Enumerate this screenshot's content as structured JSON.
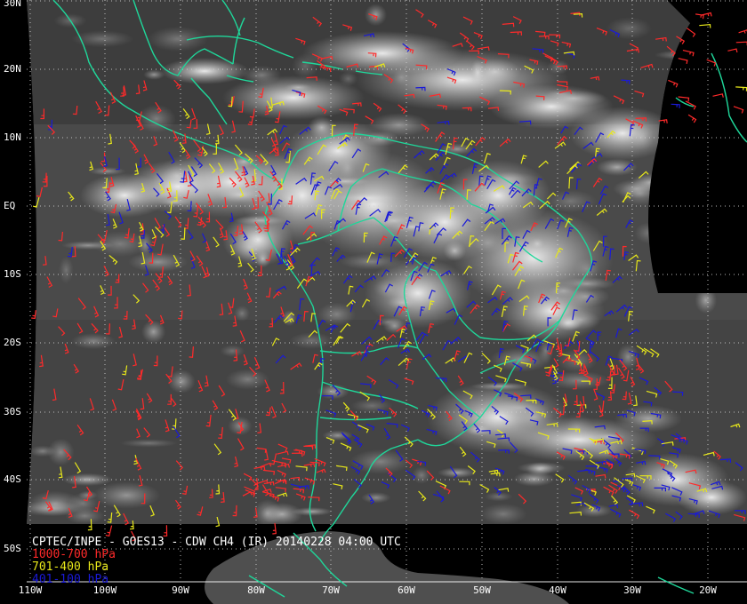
{
  "caption": "CPTEC/INPE - GOES13 - CDW CH4 (IR) 20140228 04:00 UTC",
  "legend": [
    {
      "label": "1000-700 hPa",
      "color": "#ff2a2a"
    },
    {
      "label": "701-400 hPa",
      "color": "#e8e81a"
    },
    {
      "label": "401-100 hPa",
      "color": "#1a1ad8"
    }
  ],
  "lat_labels": [
    "30N",
    "20N",
    "10N",
    "EQ",
    "10S",
    "20S",
    "30S",
    "40S",
    "50S"
  ],
  "lon_labels": [
    "110W",
    "100W",
    "90W",
    "80W",
    "70W",
    "60W",
    "50W",
    "40W",
    "30W",
    "20W"
  ],
  "colors": {
    "background": "#000000",
    "coastline": "#1fd79a",
    "graticule": "#d0d0d0",
    "disk": "#4a4a4a"
  }
}
